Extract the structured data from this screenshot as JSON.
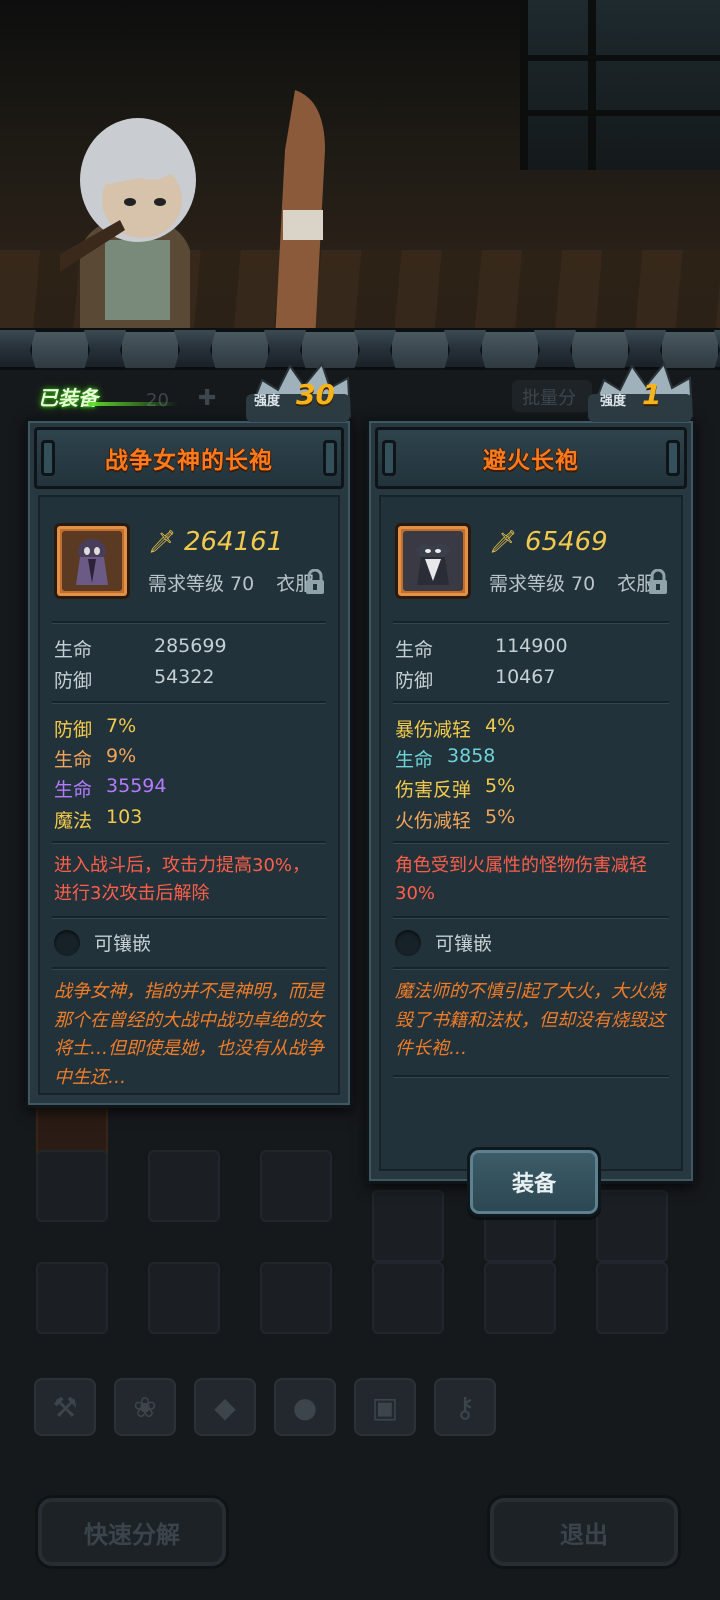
{
  "left_card": {
    "equipped_tag": "已装备",
    "strength_label": "强度",
    "strength": "30",
    "title": "战争女神的长袍",
    "power": "264161",
    "required_level": "需求等级 70",
    "item_type": "衣服",
    "base_stats": [
      {
        "name": "生命",
        "value": "285699"
      },
      {
        "name": "防御",
        "value": "54322"
      }
    ],
    "extra_stats": [
      {
        "name": "防御",
        "value": "7%",
        "color": "#f2c94c"
      },
      {
        "name": "生命",
        "value": "9%",
        "color": "#f2a55a"
      },
      {
        "name": "生命",
        "value": "35594",
        "color": "#b57bff"
      },
      {
        "name": "魔法",
        "value": "103",
        "color": "#f2c94c"
      }
    ],
    "effect": "进入战斗后，攻击力提高30%，进行3次攻击后解除",
    "socket_label": "可镶嵌",
    "lore": "战争女神，指的并不是神明，而是那个在曾经的大战中战功卓绝的女将士…但即使是她，也没有从战争中生还…"
  },
  "right_card": {
    "strength_label": "强度",
    "strength": "1",
    "title": "避火长袍",
    "power": "65469",
    "required_level": "需求等级 70",
    "item_type": "衣服",
    "base_stats": [
      {
        "name": "生命",
        "value": "114900"
      },
      {
        "name": "防御",
        "value": "10467"
      }
    ],
    "extra_stats": [
      {
        "name": "暴伤减轻",
        "value": "4%",
        "color": "#f2c94c"
      },
      {
        "name": "生命",
        "value": "3858",
        "color": "#6fd3d8"
      },
      {
        "name": "伤害反弹",
        "value": "5%",
        "color": "#f2c94c"
      },
      {
        "name": "火伤减轻",
        "value": "5%",
        "color": "#f2a55a"
      }
    ],
    "effect": "角色受到火属性的怪物伤害减轻30%",
    "socket_label": "可镶嵌",
    "lore": "魔法师的不慎引起了大火，大火烧毁了书籍和法杖，但却没有烧毁这件长袍…",
    "equip_button": "装备"
  },
  "background": {
    "count_text": "20",
    "batch_text": "批量分",
    "quick_decompose": "快速分解",
    "exit": "退出",
    "category_icons": [
      "hammer-icon",
      "paw-icon",
      "gem-icon",
      "bag-icon",
      "chest-icon",
      "key-icon"
    ]
  },
  "colors": {
    "title_orange": "#ff7a1a",
    "power_gold": "#f2c94c",
    "effect_red": "#ff5e4a",
    "lore_orange": "#f07c28",
    "card_bg": "#273840"
  }
}
